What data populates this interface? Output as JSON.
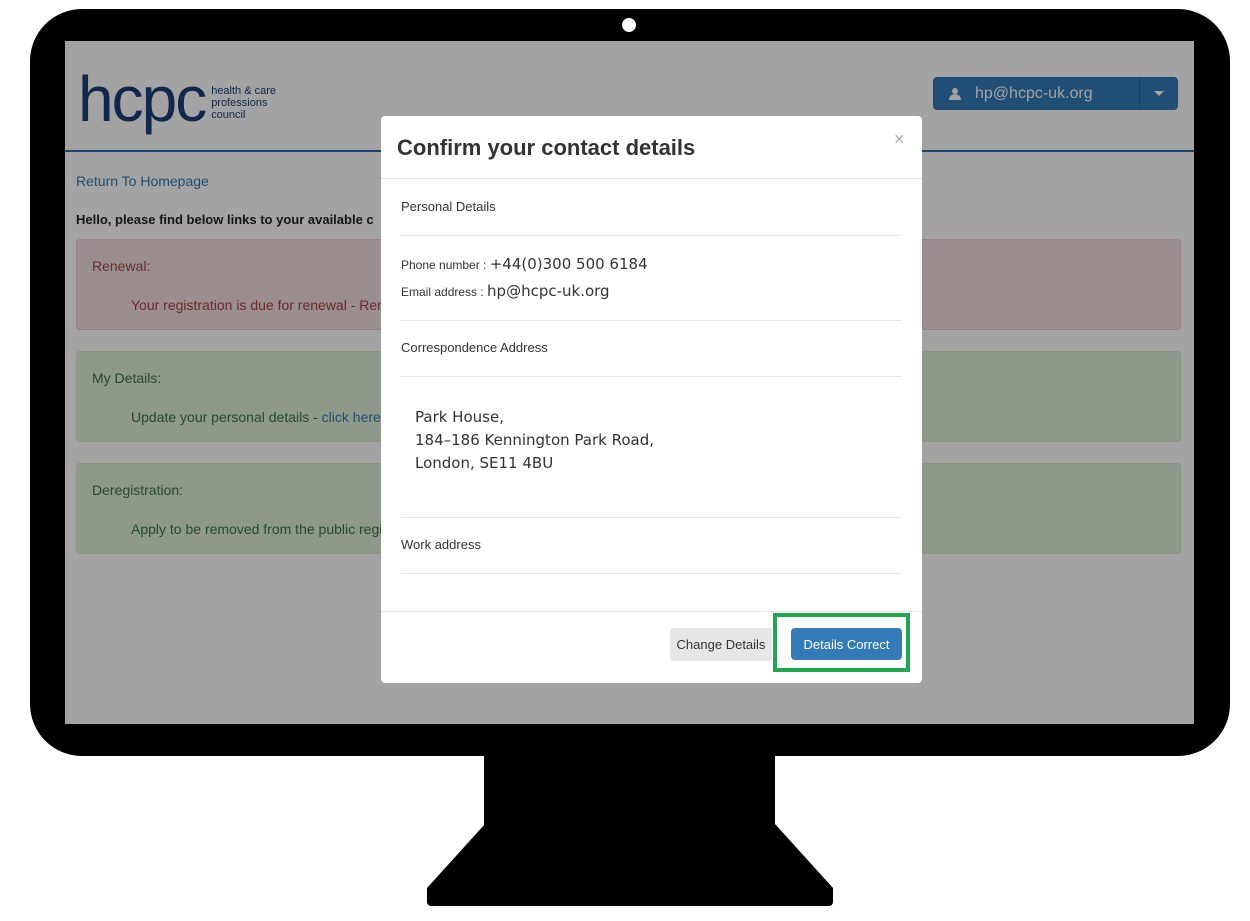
{
  "site": {
    "logo_word": "hcpc",
    "logo_line1": "health & care",
    "logo_line2": "professions",
    "logo_line3": "council",
    "user_email": "hp@hcpc-uk.org"
  },
  "page": {
    "return_link": "Return To Homepage",
    "hello_text": "Hello, please find below links to your available c",
    "renewal": {
      "title": "Renewal:",
      "body": "Your registration is due for renewal - Rene"
    },
    "my_details": {
      "title": "My Details:",
      "body": "Update your personal details - ",
      "link": "click here t"
    },
    "deregistration": {
      "title": "Deregistration:",
      "body": "Apply to be removed from the public regis"
    }
  },
  "modal": {
    "title": "Confirm your contact details",
    "close_symbol": "×",
    "personal_details_label": "Personal Details",
    "phone_label": "Phone number : ",
    "phone_value": "+44(0)300 500 6184",
    "email_label": "Email address : ",
    "email_value": "hp@hcpc-uk.org",
    "correspondence_label": "Correspondence Address",
    "address_line1": "Park House,",
    "address_line2": "184–186 Kennington Park Road,",
    "address_line3": "London, SE11 4BU",
    "work_address_label": "Work address",
    "change_button": "Change Details",
    "correct_button": "Details Correct"
  },
  "colors": {
    "brand_blue": "#337ab7",
    "highlight_green": "#1fa84f"
  }
}
